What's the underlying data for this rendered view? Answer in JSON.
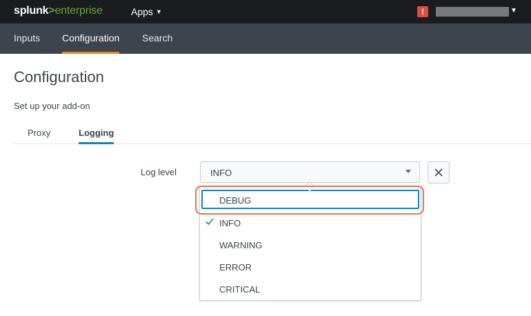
{
  "header": {
    "logo_brand": "splunk",
    "logo_separator": ">",
    "logo_product": "enterprise",
    "apps_label": "Apps",
    "alert_glyph": "!"
  },
  "nav": {
    "tabs": [
      {
        "label": "Inputs",
        "active": false
      },
      {
        "label": "Configuration",
        "active": true
      },
      {
        "label": "Search",
        "active": false
      }
    ]
  },
  "page": {
    "title": "Configuration",
    "subtitle": "Set up your add-on"
  },
  "config_tabs": [
    {
      "label": "Proxy",
      "active": false
    },
    {
      "label": "Logging",
      "active": true
    }
  ],
  "log_level": {
    "label": "Log level",
    "value": "INFO",
    "options": [
      {
        "label": "DEBUG",
        "selected": false,
        "focused": true
      },
      {
        "label": "INFO",
        "selected": true,
        "focused": false
      },
      {
        "label": "WARNING",
        "selected": false,
        "focused": false
      },
      {
        "label": "ERROR",
        "selected": false,
        "focused": false
      },
      {
        "label": "CRITICAL",
        "selected": false,
        "focused": false
      }
    ]
  },
  "colors": {
    "topbar": "#1a1c20",
    "navbar": "#3c444d",
    "active_nav_underline": "#f58220",
    "active_tab_underline": "#1a7fb8",
    "focus_ring": "#1a7fb8",
    "annotation": "#e8734a",
    "alert": "#dc4e41",
    "logo_accent": "#65a637"
  }
}
